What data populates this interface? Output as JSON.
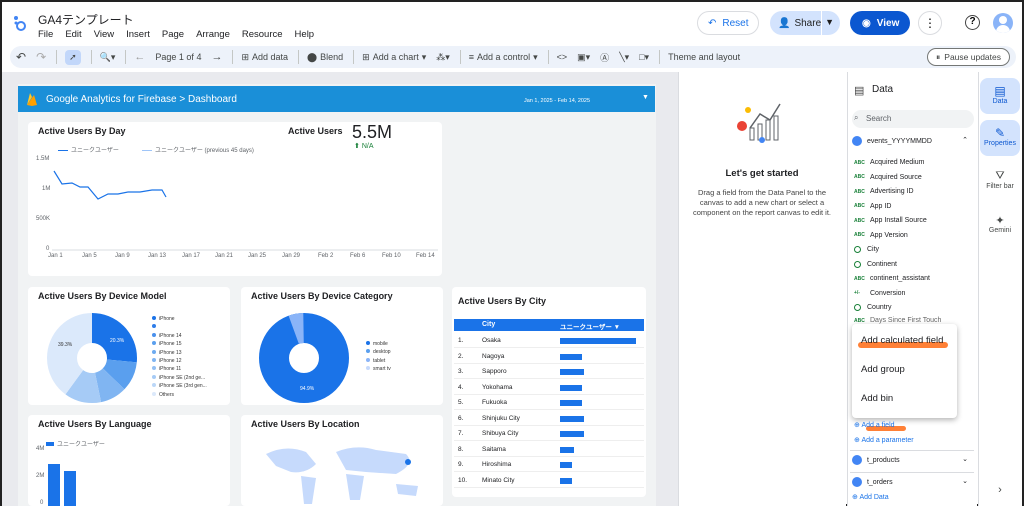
{
  "app": {
    "title": "GA4テンプレート",
    "menu": [
      "File",
      "Edit",
      "View",
      "Insert",
      "Page",
      "Arrange",
      "Resource",
      "Help"
    ],
    "reset": "Reset",
    "share": "Share",
    "view": "View"
  },
  "toolbar": {
    "page": "Page 1 of 4",
    "add_data": "Add data",
    "blend": "Blend",
    "add_chart": "Add a chart",
    "add_control": "Add a control",
    "theme": "Theme and layout",
    "pause": "Pause updates"
  },
  "report": {
    "header_title": "Google Analytics for Firebase > Dashboard",
    "date_range": "Jan 1, 2025 - Feb 14, 2025",
    "by_day": {
      "title": "Active Users By Day",
      "legend": [
        "ユニークユーザー",
        "ユニークユーザー (previous 45 days)"
      ],
      "y_ticks": [
        "1.5M",
        "1M",
        "500K",
        "0"
      ],
      "x_ticks": [
        "Jan 1",
        "Jan 5",
        "Jan 9",
        "Jan 13",
        "Jan 17",
        "Jan 21",
        "Jan 25",
        "Jan 29",
        "Feb 2",
        "Feb 6",
        "Feb 10",
        "Feb 14"
      ]
    },
    "scorecard": {
      "label": "Active Users",
      "value": "5.5M",
      "delta": "N/A"
    },
    "device_model": {
      "title": "Active Users By Device Model",
      "legend": [
        "iPhone",
        "",
        "iPhone 14",
        "iPhone 15",
        "iPhone 13",
        "iPhone 12",
        "iPhone 11",
        "iPhone SE (2nd ge...",
        "iPhone SE (3rd gen...",
        "Others"
      ],
      "pct_a": "20.3%",
      "pct_b": "39.3%"
    },
    "device_category": {
      "title": "Active Users By Device Category",
      "legend": [
        "mobile",
        "desktop",
        "tablet",
        "smart tv"
      ],
      "pct": "94.9%"
    },
    "city": {
      "title": "Active Users By City",
      "col_city": "City",
      "col_users": "ユニークユーザー ▼",
      "rows": [
        {
          "n": "1.",
          "city": "Osaka"
        },
        {
          "n": "2.",
          "city": "Nagoya"
        },
        {
          "n": "3.",
          "city": "Sapporo"
        },
        {
          "n": "4.",
          "city": "Yokohama"
        },
        {
          "n": "5.",
          "city": "Fukuoka"
        },
        {
          "n": "6.",
          "city": "Shinjuku City"
        },
        {
          "n": "7.",
          "city": "Shibuya City"
        },
        {
          "n": "8.",
          "city": "Saitama"
        },
        {
          "n": "9.",
          "city": "Hiroshima"
        },
        {
          "n": "10.",
          "city": "Minato City"
        }
      ]
    },
    "language": {
      "title": "Active Users By Language",
      "legend": "ユニークユーザー",
      "y_ticks": [
        "4M",
        "2M",
        "0"
      ]
    },
    "location": {
      "title": "Active Users By Location"
    }
  },
  "getstarted": {
    "title": "Let's get started",
    "text": "Drag a field from the Data Panel to the canvas to add a new chart or select a component on the report canvas to edit it."
  },
  "data_panel": {
    "title": "Data",
    "search_placeholder": "Search",
    "datasource": "events_YYYYMMDD",
    "fields": [
      {
        "type": "ABC",
        "name": "Acquired Medium"
      },
      {
        "type": "ABC",
        "name": "Acquired Source"
      },
      {
        "type": "ABC",
        "name": "Advertising ID"
      },
      {
        "type": "ABC",
        "name": "App ID"
      },
      {
        "type": "ABC",
        "name": "App Install Source"
      },
      {
        "type": "ABC",
        "name": "App Version"
      },
      {
        "type": "globe",
        "name": "City"
      },
      {
        "type": "globe",
        "name": "Continent"
      },
      {
        "type": "ABC",
        "name": "continent_assistant"
      },
      {
        "type": "+/-",
        "name": "Conversion"
      },
      {
        "type": "globe",
        "name": "Country"
      }
    ],
    "partial_field": "Days Since First Touch",
    "context_menu": [
      "Add calculated field",
      "Add group",
      "Add bin"
    ],
    "add_field": "Add a field",
    "add_parameter": "Add a parameter",
    "ds2": "t_products",
    "ds3": "t_orders",
    "add_data": "Add Data"
  },
  "rail": {
    "data": "Data",
    "properties": "Properties",
    "filter": "Filter bar",
    "gemini": "Gemini"
  }
}
